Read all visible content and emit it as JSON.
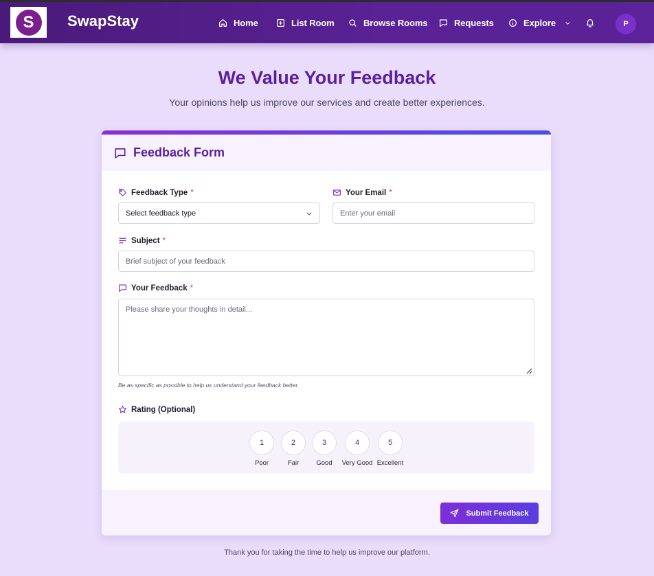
{
  "app": {
    "brand": "SwapStay",
    "logo_letter": "S"
  },
  "nav": {
    "items": [
      {
        "label": "Home",
        "icon": "home-icon"
      },
      {
        "label": "List Room",
        "icon": "plus-square-icon"
      },
      {
        "label": "Browse Rooms",
        "icon": "search-icon"
      },
      {
        "label": "Requests",
        "icon": "chat-icon"
      },
      {
        "label": "Explore",
        "icon": "info-icon"
      }
    ],
    "avatar_initial": "P"
  },
  "page": {
    "title": "We Value Your Feedback",
    "subtitle": "Your opinions help us improve our services and create better experiences.",
    "footer_note": "Thank you for taking the time to help us improve our platform."
  },
  "form": {
    "title": "Feedback Form",
    "required_mark": "*",
    "feedback_type": {
      "label": "Feedback Type",
      "value": "Select feedback type"
    },
    "email": {
      "label": "Your Email",
      "placeholder": "Enter your email"
    },
    "subject": {
      "label": "Subject",
      "placeholder": "Brief subject of your feedback"
    },
    "feedback": {
      "label": "Your Feedback",
      "placeholder": "Please share your thoughts in detail...",
      "hint": "Be as specific as possible to help us understand your feedback better."
    },
    "rating": {
      "label": "Rating (Optional)",
      "options": [
        {
          "value": "1",
          "label": "Poor"
        },
        {
          "value": "2",
          "label": "Fair"
        },
        {
          "value": "3",
          "label": "Good"
        },
        {
          "value": "4",
          "label": "Very Good"
        },
        {
          "value": "5",
          "label": "Excellent"
        }
      ]
    },
    "submit_label": "Submit Feedback"
  },
  "colors": {
    "accent": "#5b1f9e",
    "nav_bg": "#4a1a7a",
    "page_bg": "#e9ddfb",
    "required": "#d93a5b"
  }
}
